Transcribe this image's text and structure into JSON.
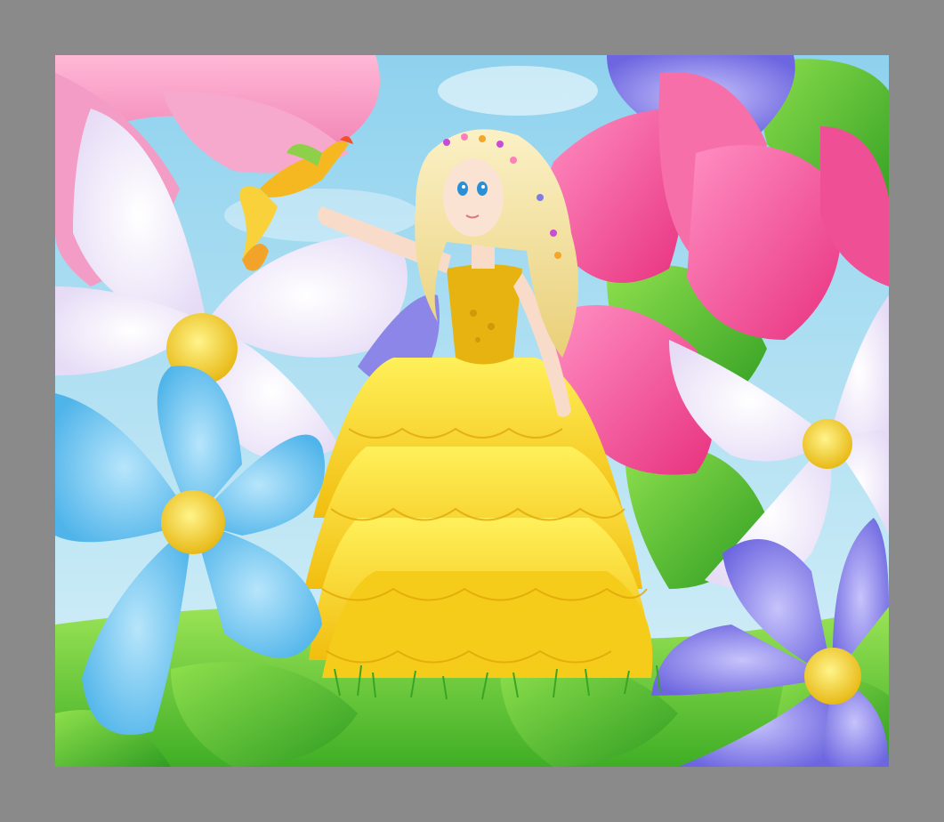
{
  "frame": {
    "mat_color": "#8a8a8a"
  },
  "artwork": {
    "subject": "illustration",
    "palette": {
      "sky": "#9fd8ef",
      "dress": "#f7d21c",
      "hair": "#f4e3a6",
      "blue_flower": "#6cc3ef",
      "violet_flower": "#7f7be6",
      "pink_tulip": "#f45b9f",
      "white_flower": "#f3eefc",
      "leaf": "#5cc23a",
      "grass": "#7ad63f"
    },
    "icons": {
      "bird": "phoenix-bird-icon",
      "flowers": "flower-icon"
    }
  }
}
